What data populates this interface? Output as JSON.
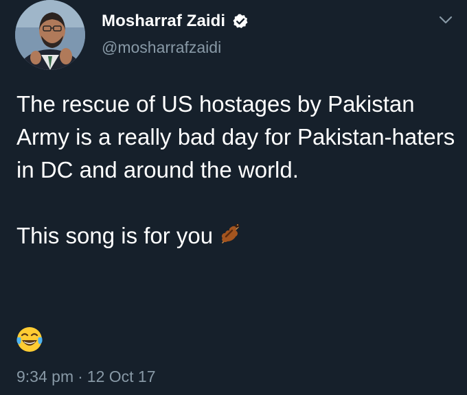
{
  "tweet": {
    "author": {
      "display_name": "Mosharraf Zaidi",
      "handle": "@mosharrafzaidi",
      "verified": true,
      "avatar_icon": "avatar-photo"
    },
    "menu_icon": "chevron-down-icon",
    "text_paragraphs": [
      "The rescue of US hostages by Pakistan Army is a really bad day for Pakistan-haters in DC and around the world.",
      "This song is for you"
    ],
    "inline_emoji": "violin-emoji",
    "trailing_emoji": "face-with-tears-of-joy-emoji",
    "time": "9:34 pm",
    "separator": "·",
    "date": "12 Oct 17"
  },
  "colors": {
    "background": "#16202b",
    "primary_text": "#ffffff",
    "secondary_text": "#8899a6"
  }
}
